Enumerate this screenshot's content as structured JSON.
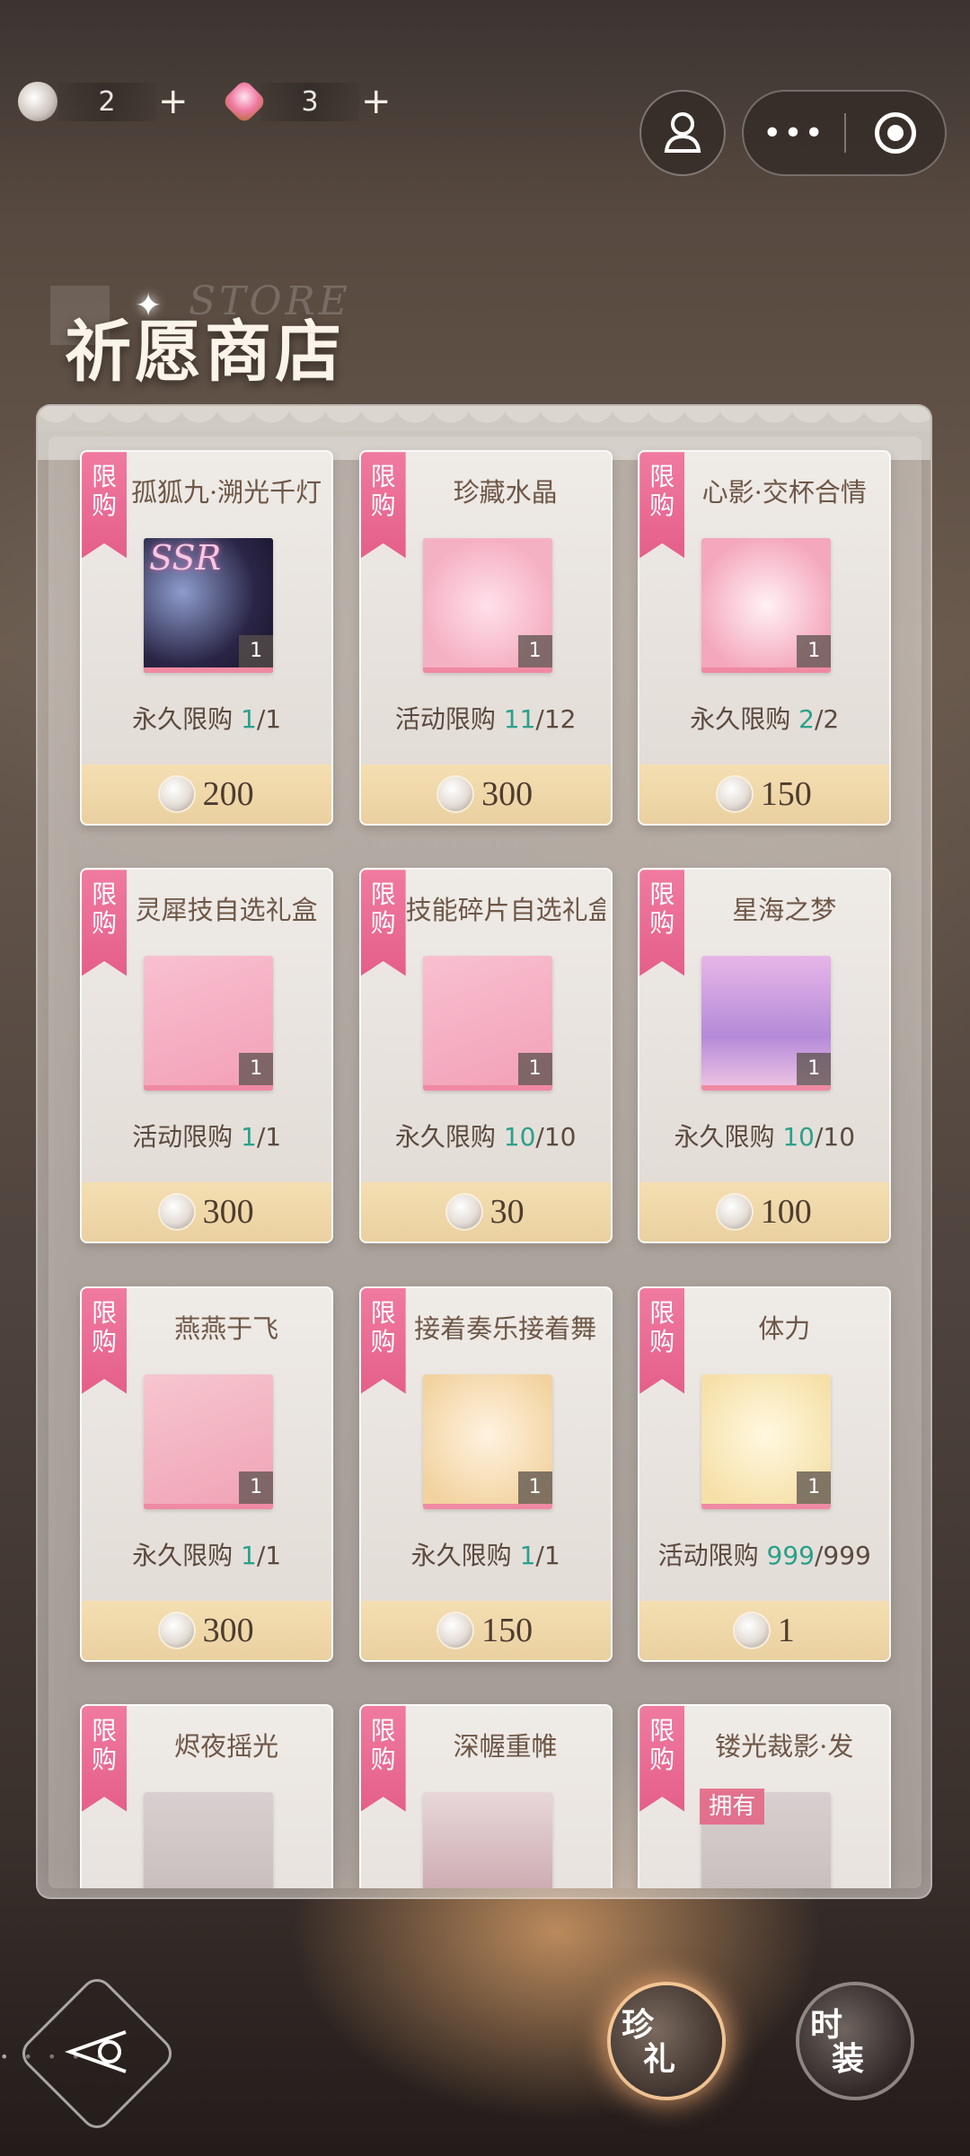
{
  "currency": [
    {
      "icon": "wish-coin-icon",
      "value": "2",
      "plus": "+"
    },
    {
      "icon": "pink-crystal-icon",
      "value": "3",
      "plus": "+"
    }
  ],
  "top_right": {
    "profile_icon": "profile-icon",
    "more_label": "•••",
    "target_icon": "target-icon"
  },
  "page": {
    "title": "祈愿商店",
    "ghost_text": "STORE"
  },
  "badge_text": "限购",
  "items": [
    {
      "name": "孤狐九·溯光千灯",
      "qty": "1",
      "limit_type": "永久限购",
      "used": "1",
      "total": "/1",
      "price": "200",
      "art": "ssr",
      "ssr": "SSR"
    },
    {
      "name": "珍藏水晶",
      "qty": "1",
      "limit_type": "活动限购",
      "used": "11",
      "total": "/12",
      "price": "300",
      "art": "crystal"
    },
    {
      "name": "心影·交杯合情",
      "qty": "1",
      "limit_type": "永久限购",
      "used": "2",
      "total": "/2",
      "price": "150",
      "art": "card"
    },
    {
      "name": "灵犀技自选礼盒",
      "qty": "1",
      "limit_type": "活动限购",
      "used": "1",
      "total": "/1",
      "price": "300",
      "art": "box"
    },
    {
      "name": "技能碎片自选礼盒",
      "qty": "1",
      "limit_type": "永久限购",
      "used": "10",
      "total": "/10",
      "price": "30",
      "art": "box"
    },
    {
      "name": "星海之梦",
      "qty": "1",
      "limit_type": "永久限购",
      "used": "10",
      "total": "/10",
      "price": "100",
      "art": "whale"
    },
    {
      "name": "燕燕于飞",
      "qty": "1",
      "limit_type": "永久限购",
      "used": "1",
      "total": "/1",
      "price": "300",
      "art": "frame"
    },
    {
      "name": "接着奏乐接着舞",
      "qty": "1",
      "limit_type": "永久限购",
      "used": "1",
      "total": "/1",
      "price": "150",
      "art": "chibi"
    },
    {
      "name": "体力",
      "qty": "1",
      "limit_type": "活动限购",
      "used": "999",
      "total": "/999",
      "price": "1",
      "art": "orb"
    },
    {
      "name": "烬夜摇光",
      "art": "gray"
    },
    {
      "name": "深幄重帷",
      "art": "dark"
    },
    {
      "name": "镂光裁影·发",
      "art": "gray",
      "owned": "拥有"
    }
  ],
  "bottom_nav": {
    "back_icon": "back-arrow-icon",
    "gift_tab": [
      "珍",
      "礼"
    ],
    "fashion_tab": [
      "时",
      "装"
    ]
  }
}
